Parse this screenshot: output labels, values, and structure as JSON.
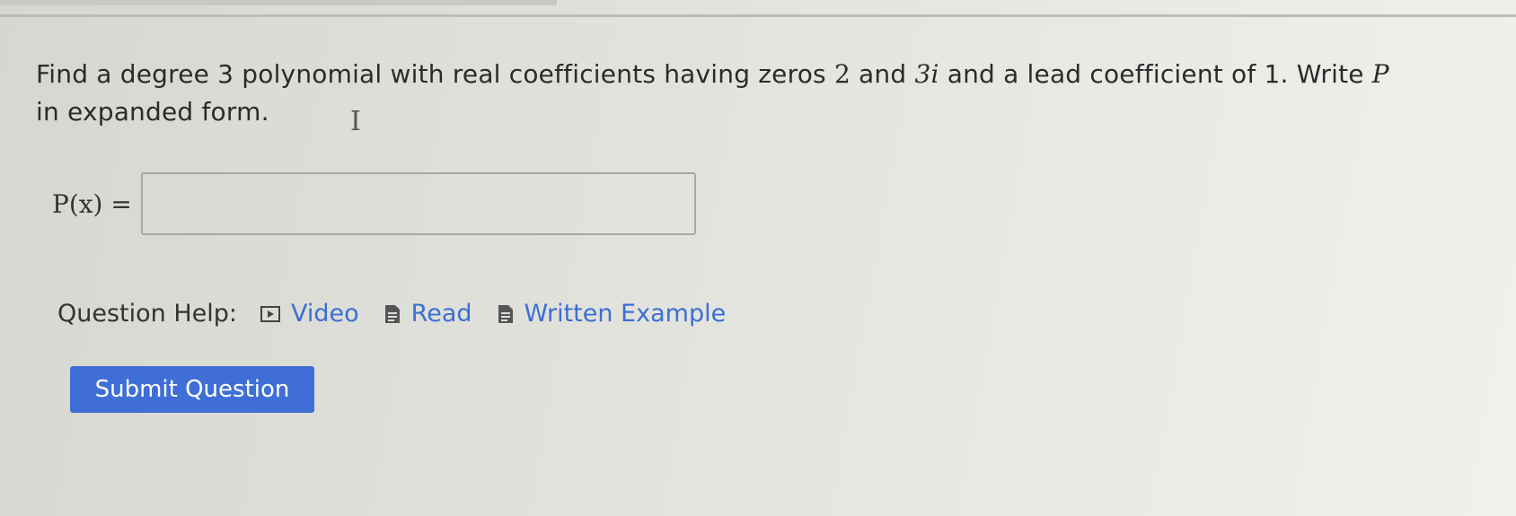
{
  "question": {
    "text_before_zero1": "Find a degree 3 polynomial with real coefficients having zeros ",
    "zero1": "2",
    "text_between": " and ",
    "zero2": "3i",
    "text_after": " and a lead coefficient of 1. Write ",
    "poly_symbol": "P",
    "line2": "in expanded form."
  },
  "answer": {
    "label": "P(x) =",
    "value": ""
  },
  "help": {
    "label": "Question Help:",
    "links": [
      {
        "label": "Video",
        "icon": "video-icon"
      },
      {
        "label": "Read",
        "icon": "document-icon"
      },
      {
        "label": "Written Example",
        "icon": "document-icon"
      }
    ]
  },
  "submit": {
    "label": "Submit Question",
    "color": "#3f6fd6"
  },
  "colors": {
    "link": "#3b6fd2",
    "background": "#e3e3de"
  }
}
